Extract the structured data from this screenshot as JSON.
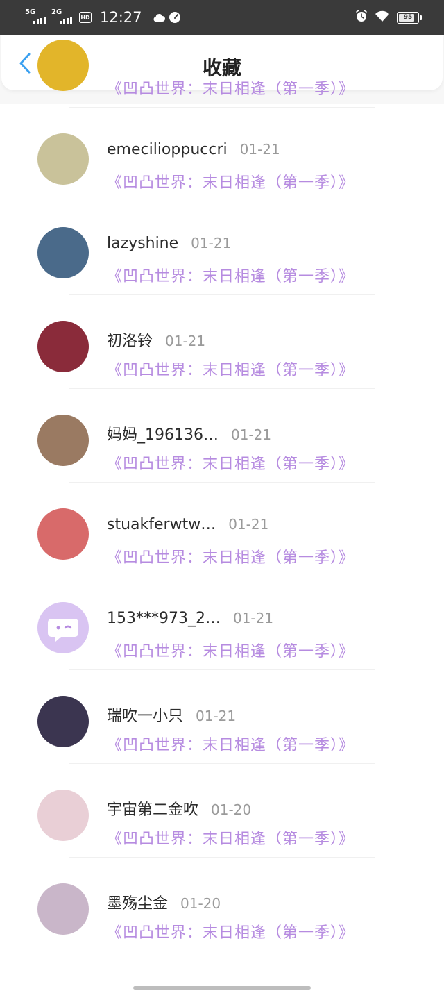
{
  "status_bar": {
    "net1": "5G",
    "net2": "2G",
    "hd": "HD",
    "time": "12:27",
    "battery": "95"
  },
  "header": {
    "title": "收藏",
    "back_icon": "chevron-left-icon"
  },
  "colors": {
    "accent": "#3aa0f0",
    "comic_title": "#b68be0",
    "date": "#9a9a9a"
  },
  "items": [
    {
      "name": "",
      "date": "",
      "comic": "《凹凸世界：末日相逢（第一季）》",
      "avatar_color": "#e2b52a"
    },
    {
      "name": "emecilioppuccri",
      "date": "01-21",
      "comic": "《凹凸世界：末日相逢（第一季）》",
      "avatar_color": "#c9c29a"
    },
    {
      "name": "lazyshine",
      "date": "01-21",
      "comic": "《凹凸世界：末日相逢（第一季）》",
      "avatar_color": "#4a6a8a"
    },
    {
      "name": "初洛铃",
      "date": "01-21",
      "comic": "《凹凸世界：末日相逢（第一季）》",
      "avatar_color": "#8a2b3a"
    },
    {
      "name": "妈妈_196136…",
      "date": "01-21",
      "comic": "《凹凸世界：末日相逢（第一季）》",
      "avatar_color": "#9a7a62"
    },
    {
      "name": "stuakferwtw…",
      "date": "01-21",
      "comic": "《凹凸世界：末日相逢（第一季）》",
      "avatar_color": "#d86a6a"
    },
    {
      "name": "153***973_2…",
      "date": "01-21",
      "comic": "《凹凸世界：末日相逢（第一季）》",
      "avatar_color": "#d9c4f2"
    },
    {
      "name": "瑞吹一小只",
      "date": "01-21",
      "comic": "《凹凸世界：末日相逢（第一季）》",
      "avatar_color": "#3b3550"
    },
    {
      "name": "宇宙第二金吹",
      "date": "01-20",
      "comic": "《凹凸世界：末日相逢（第一季）》",
      "avatar_color": "#e9cfd6"
    },
    {
      "name": "墨殇尘金",
      "date": "01-20",
      "comic": "《凹凸世界：末日相逢（第一季）》",
      "avatar_color": "#c9b6c9"
    }
  ]
}
